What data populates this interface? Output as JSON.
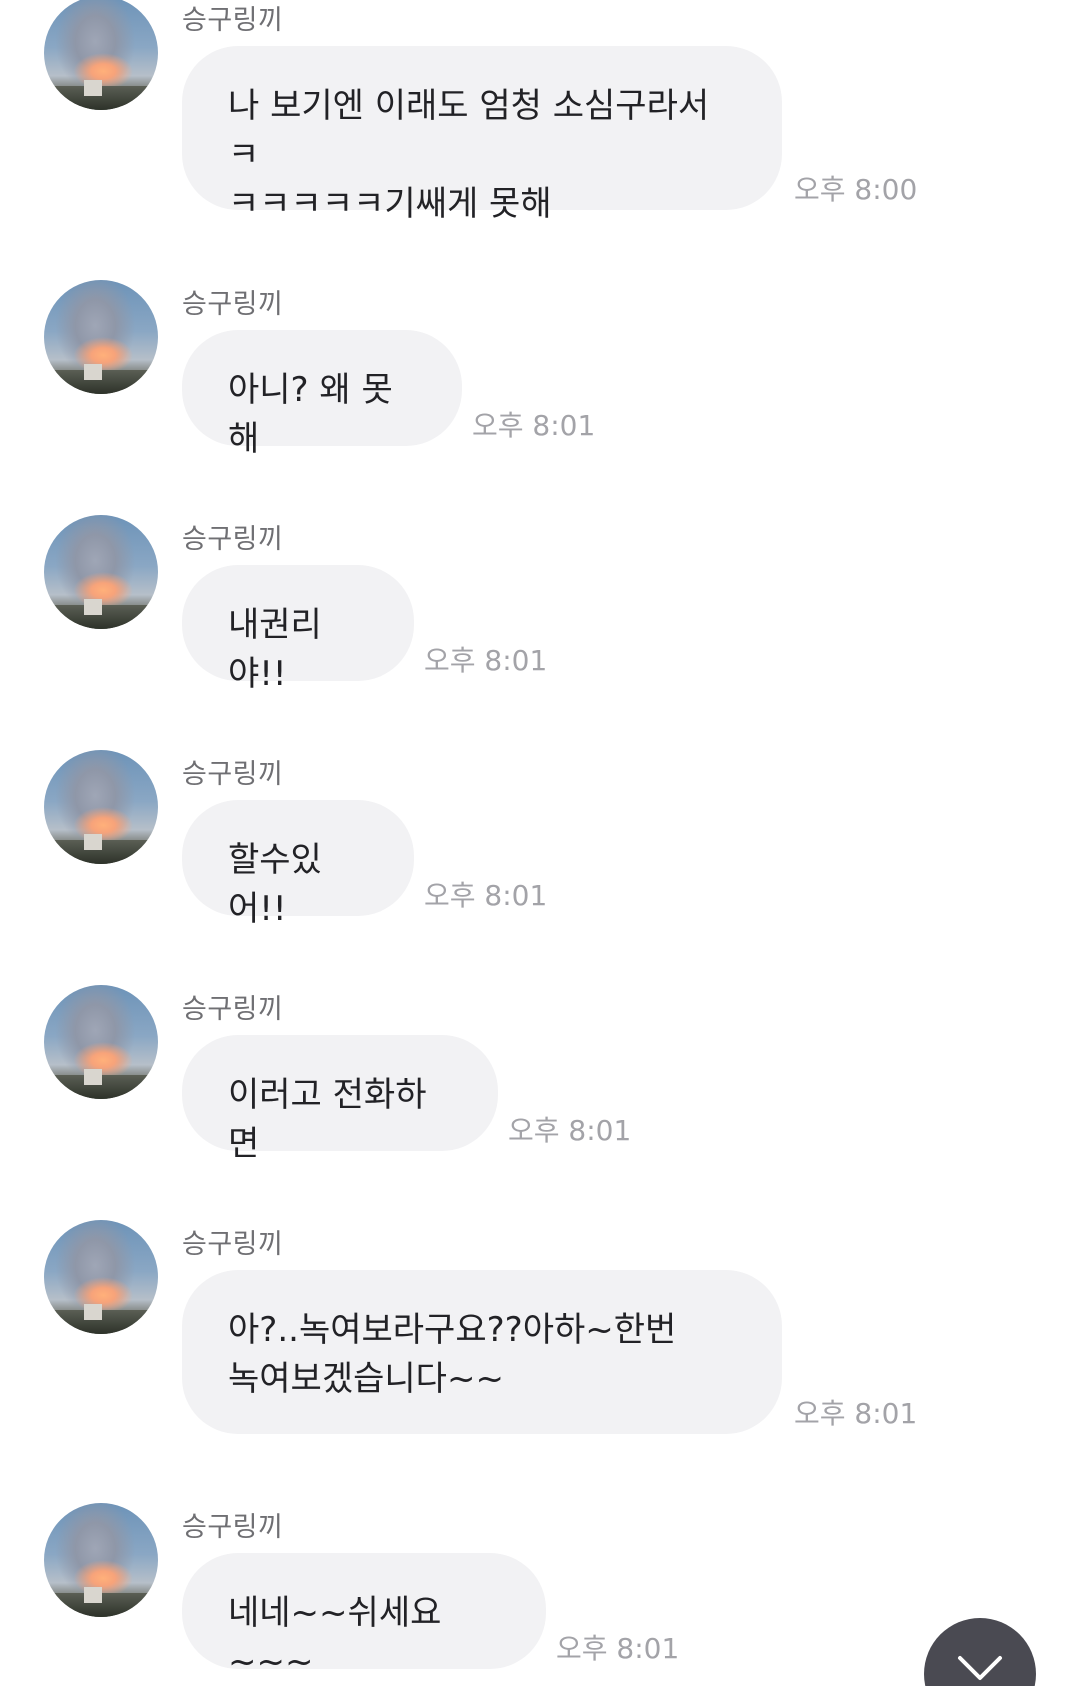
{
  "messages": [
    {
      "sender": "승구링끼",
      "text": "나 보기엔 이래도 엄청 소심구라서ㅋ\nㅋㅋㅋㅋㅋ기쌔게 못해",
      "time": "오후 8:00"
    },
    {
      "sender": "승구링끼",
      "text": "아니? 왜 못해",
      "time": "오후 8:01"
    },
    {
      "sender": "승구링끼",
      "text": "내권리야!!",
      "time": "오후 8:01"
    },
    {
      "sender": "승구링끼",
      "text": "할수있어!!",
      "time": "오후 8:01"
    },
    {
      "sender": "승구링끼",
      "text": "이러고 전화하면",
      "time": "오후 8:01"
    },
    {
      "sender": "승구링끼",
      "text": "아?..녹여보라구요??아하~한번\n녹여보겠습니다~~",
      "time": "오후 8:01"
    },
    {
      "sender": "승구링끼",
      "text": "네네~~쉬세요~~~",
      "time": "오후 8:01"
    }
  ],
  "scroll_button": {
    "icon": "chevron-down-icon"
  }
}
